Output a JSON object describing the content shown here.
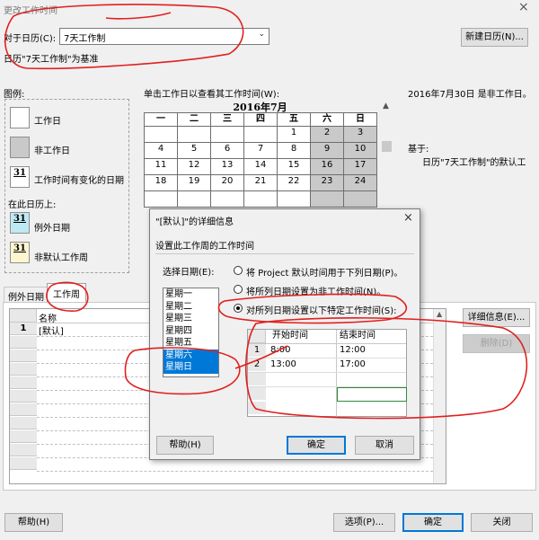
{
  "window": {
    "title": "更改工作时间",
    "close_glyph": "×"
  },
  "calendar_select": {
    "label": "对于日历(C):",
    "value": "7天工作制",
    "note": "日历\"7天工作制\"为基准",
    "new_button": "新建日历(N)..."
  },
  "legend": {
    "title": "图例:",
    "items": [
      {
        "label": "工作日"
      },
      {
        "label": "非工作日"
      },
      {
        "label": "工作时间有变化的日期",
        "num": "31"
      }
    ],
    "subtitle": "在此日历上:",
    "items2": [
      {
        "label": "例外日期",
        "num": "31"
      },
      {
        "label": "非默认工作周",
        "num": "31"
      }
    ]
  },
  "calendar": {
    "instruction": "单击工作日以查看其工作时间(W):",
    "month_title": "2016年7月",
    "weekdays": [
      "一",
      "二",
      "三",
      "四",
      "五",
      "六",
      "日"
    ],
    "rows": [
      [
        "",
        "",
        "",
        "",
        "1",
        "2",
        "3"
      ],
      [
        "4",
        "5",
        "6",
        "7",
        "8",
        "9",
        "10"
      ],
      [
        "11",
        "12",
        "13",
        "14",
        "15",
        "16",
        "17"
      ],
      [
        "18",
        "19",
        "20",
        "21",
        "22",
        "23",
        "24"
      ]
    ]
  },
  "info": {
    "status": "2016年7月30日 是非工作日。",
    "based_label": "基于:",
    "based_value": "日历\"7天工作制\"的默认工"
  },
  "tabs": [
    {
      "label": "例外日期"
    },
    {
      "label": "工作周"
    }
  ],
  "grid": {
    "col_name": "名称",
    "rows": [
      {
        "num": "1",
        "name": "[默认]"
      }
    ]
  },
  "side_buttons": {
    "details": "详细信息(E)...",
    "delete": "删除(D)"
  },
  "dialog": {
    "title": "\"[默认]\"的详细信息",
    "close_glyph": "×",
    "heading": "设置此工作周的工作时间",
    "select_label": "选择日期(E):",
    "days": [
      "星期一",
      "星期二",
      "星期三",
      "星期四",
      "星期五",
      "星期六",
      "星期日"
    ],
    "selected_days": [
      5,
      6
    ],
    "radios": [
      {
        "label": "将 Project 默认时间用于下列日期(P)。",
        "on": false
      },
      {
        "label": "将所列日期设置为非工作时间(N)。",
        "on": false
      },
      {
        "label": "对所列日期设置以下特定工作时间(S):",
        "on": true
      }
    ],
    "time_table": {
      "col_start": "开始时间",
      "col_end": "结束时间",
      "rows": [
        {
          "num": "1",
          "start": "8:00",
          "end": "12:00"
        },
        {
          "num": "2",
          "start": "13:00",
          "end": "17:00"
        }
      ]
    },
    "help_button": "帮助(H)",
    "ok_button": "确定",
    "cancel_button": "取消"
  },
  "footer": {
    "help": "帮助(H)",
    "options": "选项(P)...",
    "ok": "确定",
    "close": "关闭"
  },
  "colors": {
    "selection": "#0078d7",
    "annotation_red": "#e0201f",
    "nonworking": "#c9c9c9"
  }
}
